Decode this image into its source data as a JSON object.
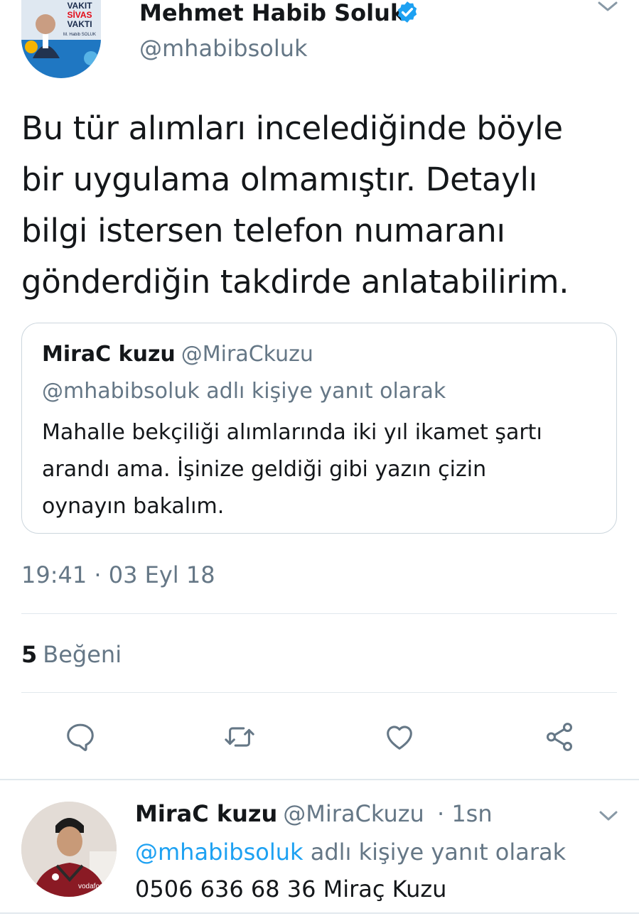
{
  "main_tweet": {
    "author": {
      "name": "Mehmet Habib Soluk",
      "handle": "@mhabibsoluk",
      "verified": true,
      "avatar_text": {
        "line1": "VAKIT",
        "line2": "SİVAS",
        "line3": "VAKTI",
        "line4": "M. Habib SOLUK"
      }
    },
    "text_lines": [
      "Bu tür alımları incelediğinde böyle",
      "bir uygulama olmamıştır. Detaylı",
      "bilgi istersen telefon numaranı",
      "gönderdiğin takdirde anlatabilirim."
    ],
    "quoted": {
      "name": "MiraC kuzu",
      "handle": "@MiraCkuzu",
      "reply_context": "@mhabibsoluk adlı kişiye yanıt olarak",
      "text_lines": [
        "Mahalle bekçiliği alımlarında iki yıl ikamet şartı",
        "arandı ama. İşinize geldiği gibi yazın çizin",
        "oynayın bakalım."
      ]
    },
    "timestamp": "19:41 · 03 Eyl 18",
    "likes": {
      "count": "5",
      "label": "Beğeni"
    },
    "actions": [
      "reply-icon",
      "retweet-icon",
      "like-icon",
      "share-icon"
    ]
  },
  "reply_tweet": {
    "name": "MiraC kuzu",
    "handle": "@MiraCkuzu",
    "time": "· 1sn",
    "reply_mention": "@mhabibsoluk",
    "reply_suffix": "adlı kişiye yanıt olarak",
    "text": "0506 636 68 36 Miraç Kuzu",
    "jersey_text": "vodafone"
  },
  "colors": {
    "text": "#14171a",
    "secondary": "#657786",
    "accent": "#1da1f2",
    "border": "#e1e8ed",
    "verified": "#1da1f2"
  }
}
